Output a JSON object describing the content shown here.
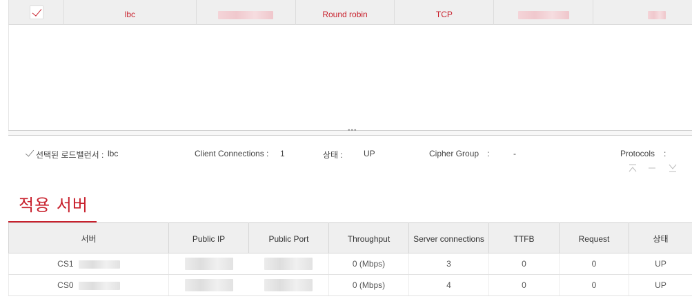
{
  "top_row": {
    "name": "lbc",
    "algorithm": "Round robin",
    "protocol": "TCP"
  },
  "info": {
    "selected_label": "선택된 로드밸런서 :",
    "selected_value": "lbc",
    "client_conn_label": "Client Connections :",
    "client_conn_value": "1",
    "status_label": "상태 :",
    "status_value": "UP",
    "cipher_label": "Cipher Group",
    "cipher_colon": ":",
    "cipher_value": "-",
    "protocols_label": "Protocols",
    "protocols_colon": ":"
  },
  "panel_icons": [
    "collapse-top-icon",
    "minimize-icon",
    "expand-bottom-icon"
  ],
  "section_title": "적용 서버",
  "table": {
    "headers": [
      "서버",
      "Public IP",
      "Public Port",
      "Throughput",
      "Server connections",
      "TTFB",
      "Request",
      "상태"
    ],
    "rows": [
      {
        "server": "CS1",
        "throughput": "0 (Mbps)",
        "connections": "3",
        "ttfb": "0",
        "request": "0",
        "status": "UP"
      },
      {
        "server": "CS0",
        "throughput": "0 (Mbps)",
        "connections": "4",
        "ttfb": "0",
        "request": "0",
        "status": "UP"
      }
    ]
  },
  "colors": {
    "accent": "#c8202c",
    "header_bg": "#efefef"
  }
}
